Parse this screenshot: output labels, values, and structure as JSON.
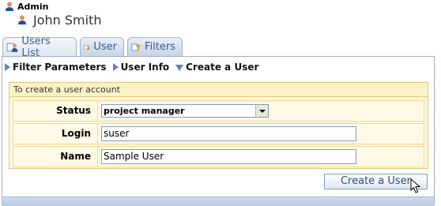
{
  "header": {
    "role": "Admin",
    "user_name": "John Smith"
  },
  "tabs": [
    {
      "label": "Users List",
      "icon": "users-list-icon",
      "active": true
    },
    {
      "label": "User",
      "icon": "user-icon",
      "active": false
    },
    {
      "label": "Filters",
      "icon": "filters-icon",
      "active": false
    }
  ],
  "subnav": {
    "filter_parameters": "Filter Parameters",
    "user_info": "User Info",
    "create_user": "Create a User"
  },
  "form": {
    "title": "To create a user account",
    "status_label": "Status",
    "status_value": "project manager",
    "login_label": "Login",
    "login_value": "suser",
    "name_label": "Name",
    "name_value": "Sample User"
  },
  "actions": {
    "create_button": "Create a User"
  },
  "colors": {
    "accent": "#5b85c1",
    "tab_text": "#3b5f8f",
    "form_bg": "#fff7dc",
    "form_border": "#e1c77b"
  }
}
